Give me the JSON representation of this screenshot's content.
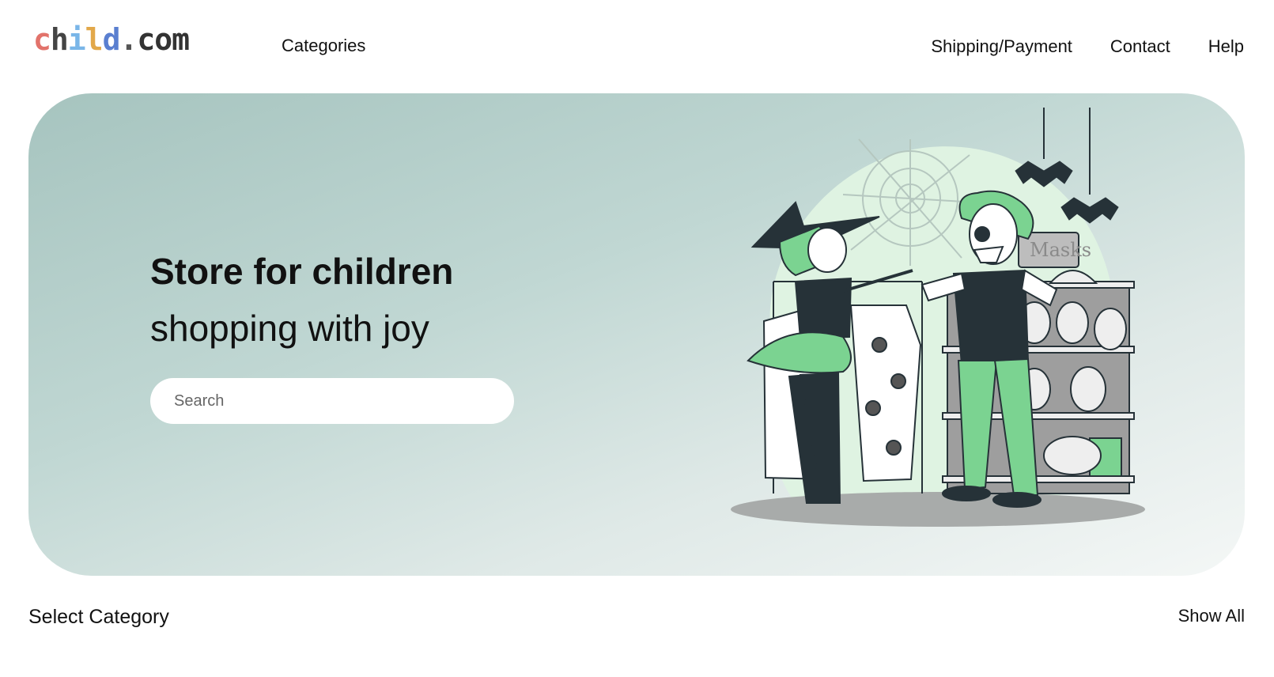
{
  "logo": {
    "letters": [
      "c",
      "h",
      "i",
      "l",
      "d",
      ".",
      "c",
      "o",
      "m"
    ],
    "colors": [
      "#e2736b",
      "#444444",
      "#7ab6e8",
      "#e2a84a",
      "#5a7fd0",
      "#555555",
      "#333333",
      "#333333",
      "#333333"
    ]
  },
  "nav": {
    "categories": "Categories",
    "links": [
      "Shipping/Payment",
      "Contact",
      "Help"
    ]
  },
  "hero": {
    "title": "Store for children",
    "subtitle": "shopping with joy",
    "search_placeholder": "Search",
    "illustration_sign": "Masks"
  },
  "section": {
    "title": "Select Category",
    "show_all": "Show All"
  },
  "colors": {
    "hero_start": "#a6c4bf",
    "hero_end": "#f4f7f6",
    "accent_green": "#7bd391",
    "dark": "#263238"
  }
}
